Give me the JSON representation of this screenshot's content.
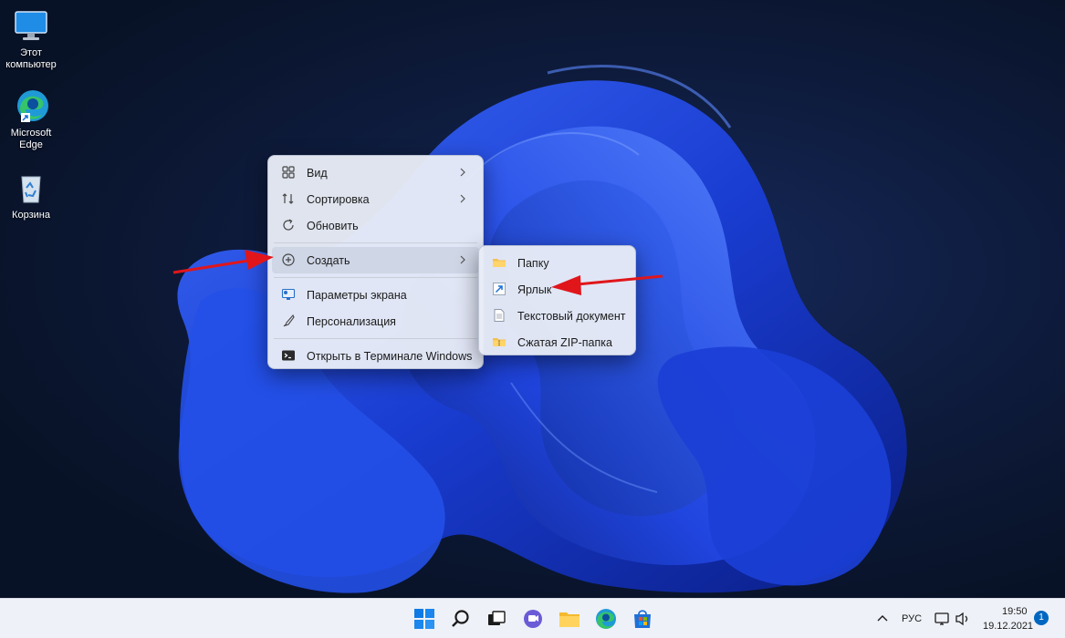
{
  "desktop": {
    "icons": [
      {
        "label": "Этот компьютер",
        "icon": "monitor-icon"
      },
      {
        "label": "Microsoft Edge",
        "icon": "edge-icon"
      },
      {
        "label": "Корзина",
        "icon": "recycle-bin-icon"
      }
    ]
  },
  "context_menu": {
    "items": [
      {
        "label": "Вид",
        "icon": "view-grid-icon",
        "has_submenu": true
      },
      {
        "label": "Сортировка",
        "icon": "sort-icon",
        "has_submenu": true
      },
      {
        "label": "Обновить",
        "icon": "refresh-icon",
        "has_submenu": false
      },
      {
        "label": "Создать",
        "icon": "create-plus-icon",
        "has_submenu": true,
        "active": true
      },
      {
        "label": "Параметры экрана",
        "icon": "display-settings-icon",
        "has_submenu": false
      },
      {
        "label": "Персонализация",
        "icon": "brush-icon",
        "has_submenu": false
      },
      {
        "label": "Открыть в Терминале Windows",
        "icon": "terminal-icon",
        "has_submenu": false
      }
    ]
  },
  "submenu": {
    "items": [
      {
        "label": "Папку",
        "icon": "folder-icon"
      },
      {
        "label": "Ярлык",
        "icon": "shortcut-arrow-icon"
      },
      {
        "label": "Текстовый документ",
        "icon": "text-document-icon"
      },
      {
        "label": "Сжатая ZIP-папка",
        "icon": "zip-folder-icon"
      }
    ]
  },
  "taskbar": {
    "pinned": [
      "start-icon",
      "search-icon",
      "task-view-icon",
      "chat-icon",
      "file-explorer-icon",
      "edge-icon",
      "store-icon"
    ],
    "tray": {
      "language": "РУС",
      "time": "19:50",
      "date": "19.12.2021",
      "notification_count": "1"
    }
  },
  "colors": {
    "accent": "#0067c0",
    "annotation_arrow": "#e0161b",
    "wallpaper_bloom": "#1f4de0"
  }
}
